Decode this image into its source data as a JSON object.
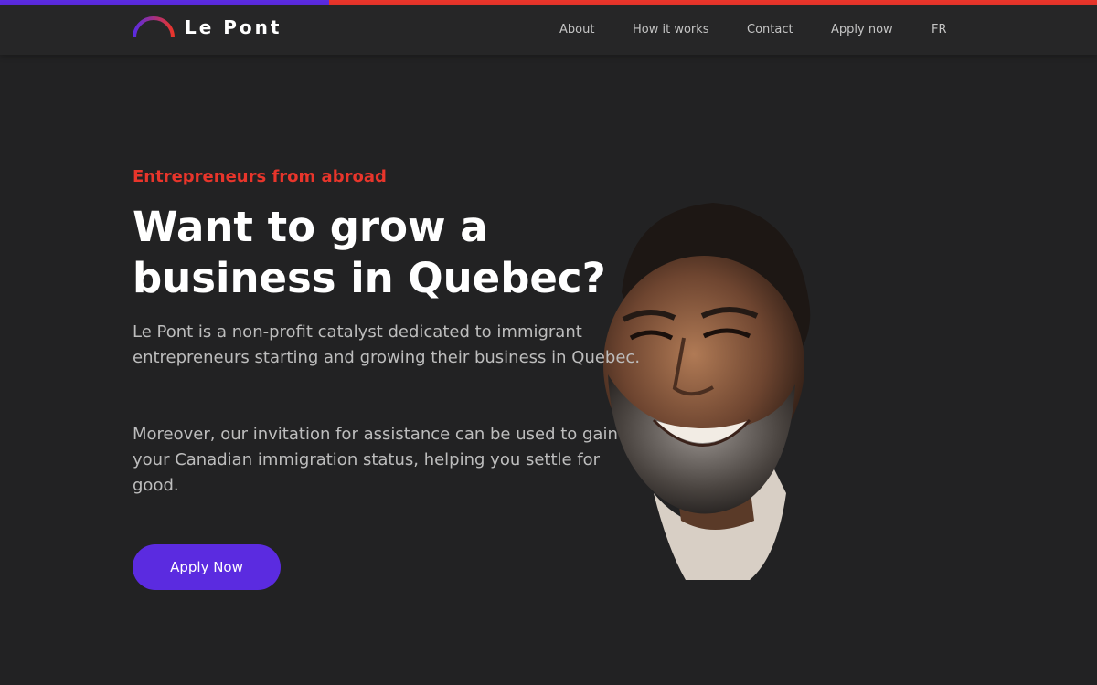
{
  "brand": {
    "name": "Le Pont",
    "colors": {
      "purple": "#5b2be0",
      "red": "#e8352b",
      "background": "#222223"
    }
  },
  "nav": {
    "items": [
      {
        "label": "About"
      },
      {
        "label": "How it works"
      },
      {
        "label": "Contact"
      },
      {
        "label": "Apply now"
      },
      {
        "label": "FR"
      }
    ]
  },
  "hero": {
    "eyebrow": "Entrepreneurs from abroad",
    "headline": "Want to grow a business in Quebec?",
    "paragraph1": "Le Pont is a non-profit catalyst dedicated to immigrant entrepreneurs starting and growing their business in Quebec.",
    "paragraph2": "Moreover, our invitation for assistance can be used to gain your Canadian immigration status, helping you settle for good.",
    "cta_label": "Apply Now",
    "image": "smiling-bearded-man-portrait"
  },
  "icons": {
    "logo": "half-arc-logo-icon"
  }
}
